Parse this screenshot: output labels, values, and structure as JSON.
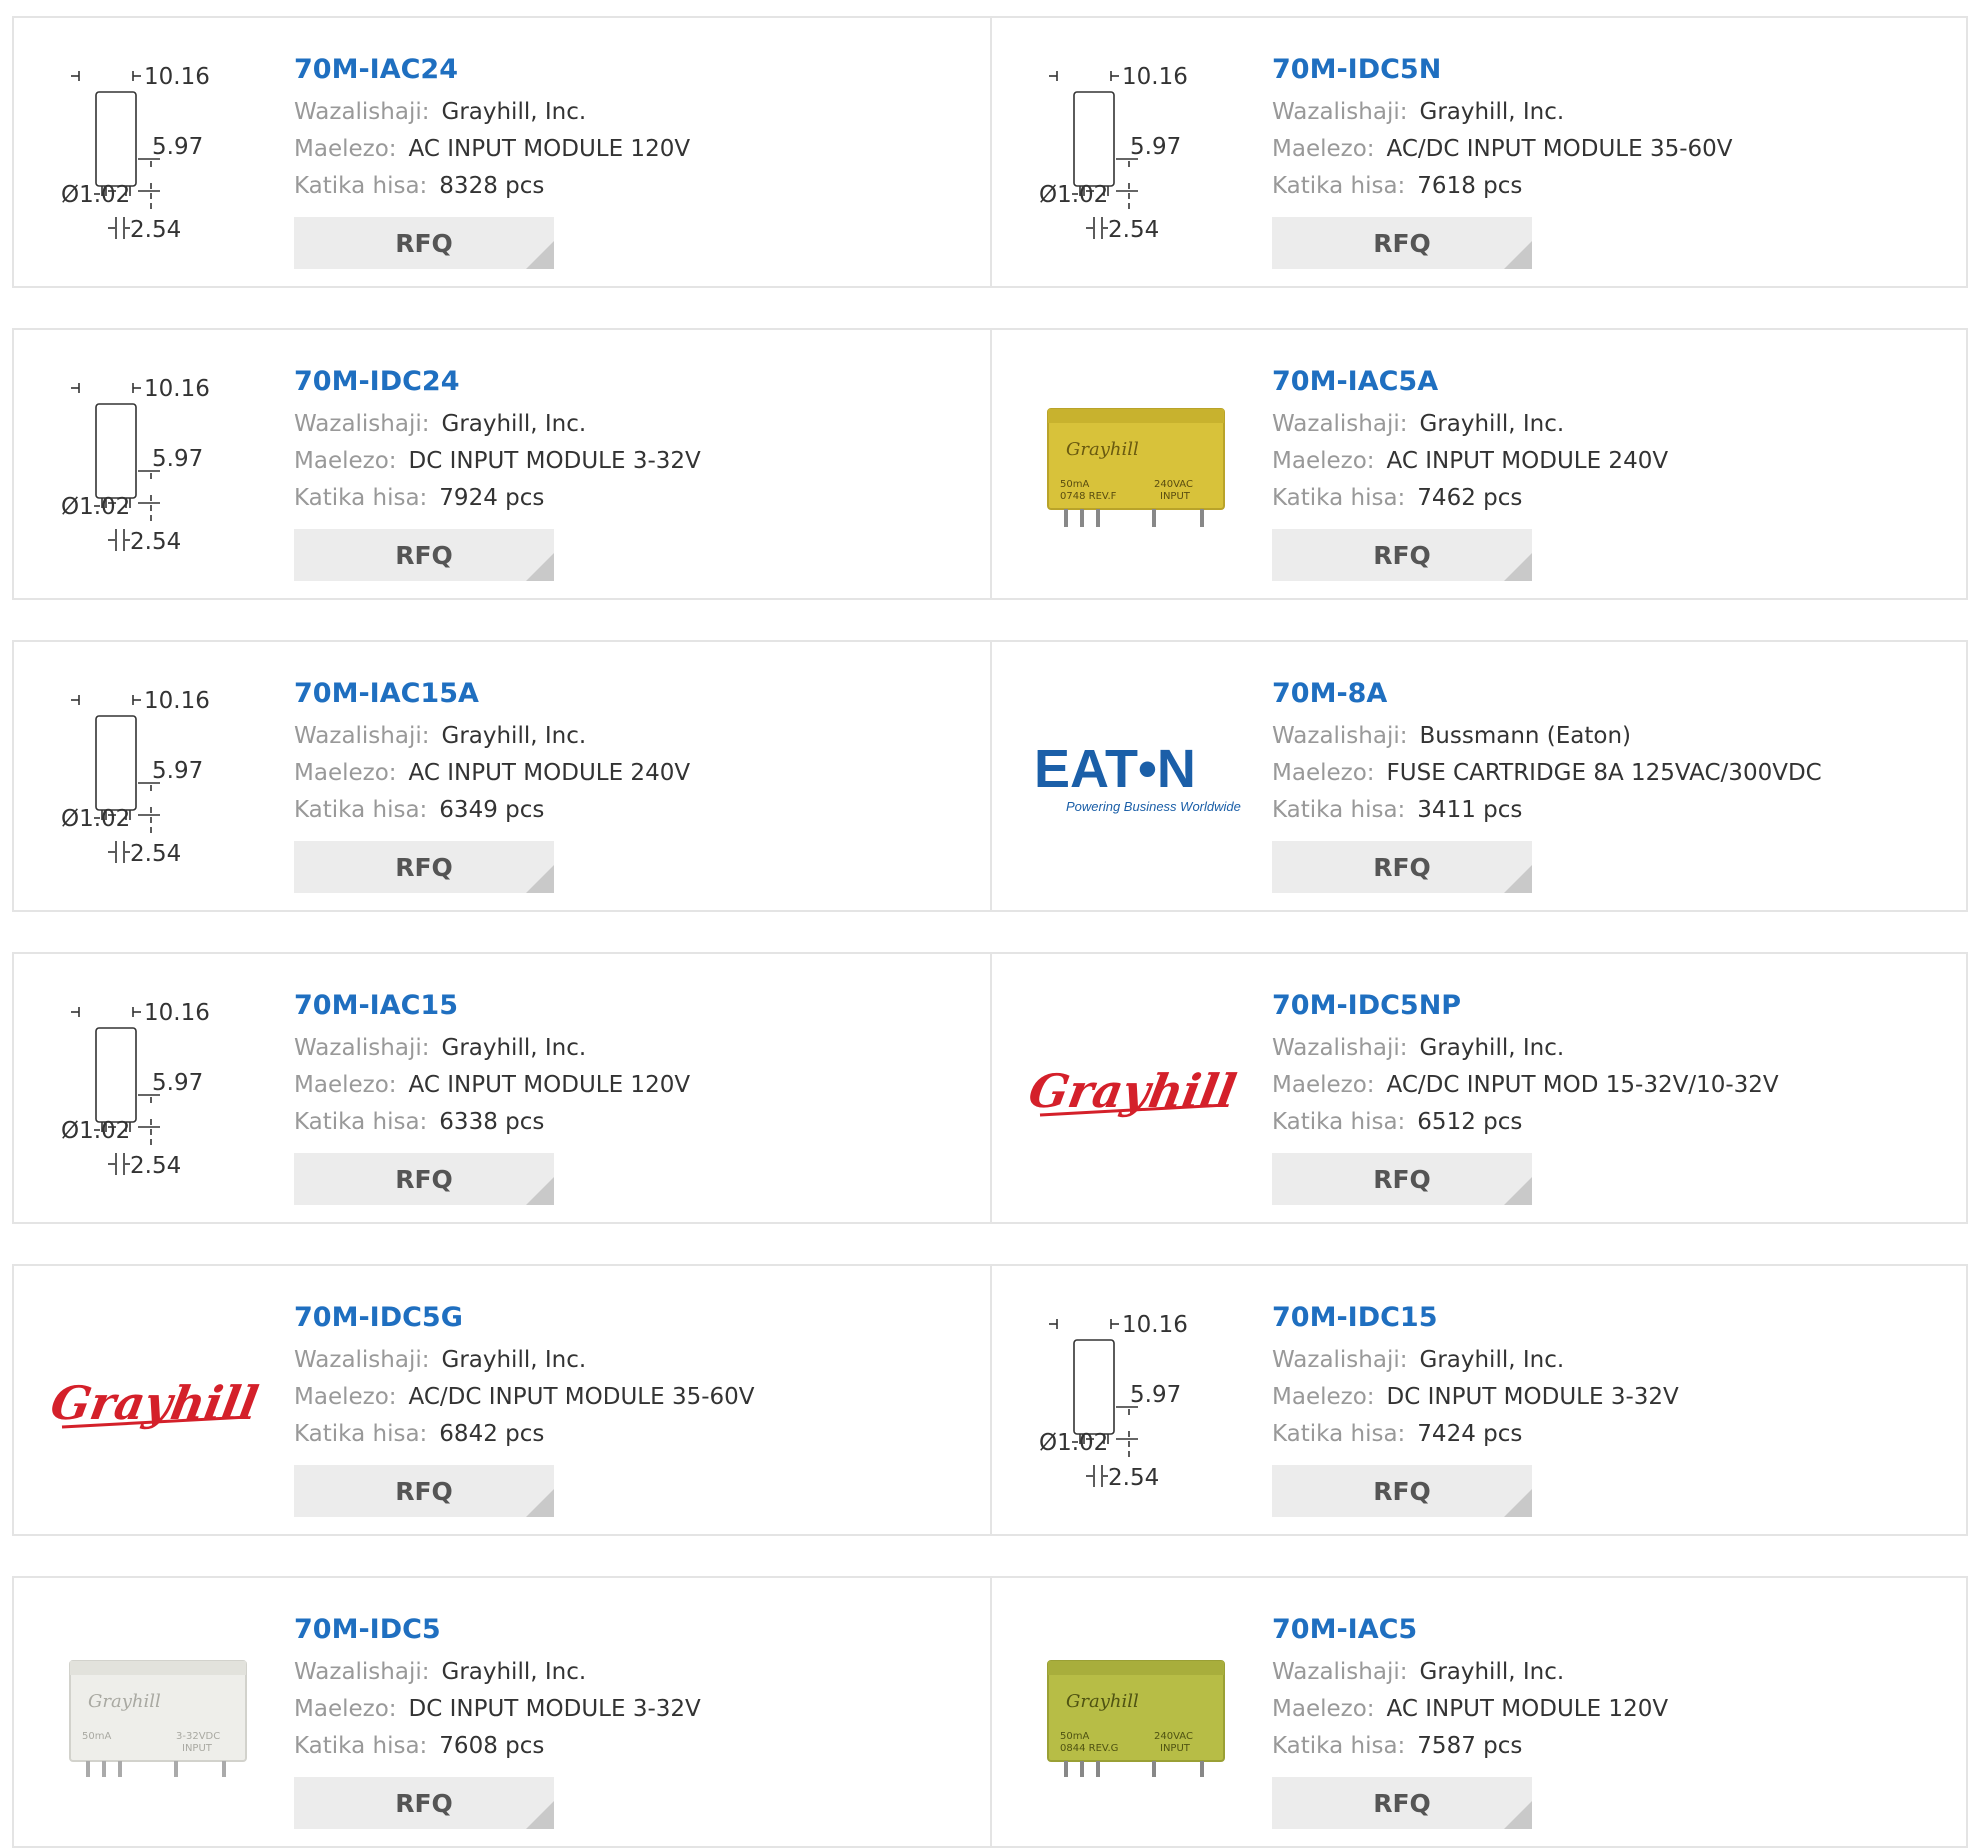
{
  "labels": {
    "manufacturer": "Wazalishaji:",
    "description": "Maelezo:",
    "stock": "Katika hisa:",
    "rfq": "RFQ"
  },
  "drawing_labels": {
    "width": "10.16",
    "height": "5.97",
    "pin_diameter": "Ø1.02",
    "pitch": "2.54"
  },
  "logos": {
    "eaton_name": "EAT•N",
    "eaton_tagline": "Powering Business Worldwide",
    "grayhill": "Grayhill"
  },
  "module_print": {
    "brand": "Grayhill",
    "current": "50mA",
    "yellow_voltage": "240VAC",
    "yellow_code": "0748 REV.F",
    "white_voltage": "3-32VDC",
    "green_voltage": "240VAC",
    "green_code": "0844 REV.G",
    "input": "INPUT"
  },
  "colors": {
    "link": "#1f6fc0",
    "eaton_blue": "#1b5fa8",
    "grayhill_red": "#d4202a",
    "module_yellow": "#d8c23a",
    "module_green": "#b7bd46",
    "module_white": "#eeeeea"
  },
  "products": [
    {
      "name": "70M-IAC24",
      "manufacturer": "Grayhill, Inc.",
      "description": "AC INPUT MODULE 120V",
      "stock": "8328 pcs",
      "image": "drawing"
    },
    {
      "name": "70M-IDC5N",
      "manufacturer": "Grayhill, Inc.",
      "description": "AC/DC INPUT MODULE 35-60V",
      "stock": "7618 pcs",
      "image": "drawing"
    },
    {
      "name": "70M-IDC24",
      "manufacturer": "Grayhill, Inc.",
      "description": "DC INPUT MODULE 3-32V",
      "stock": "7924 pcs",
      "image": "drawing"
    },
    {
      "name": "70M-IAC5A",
      "manufacturer": "Grayhill, Inc.",
      "description": "AC INPUT MODULE 240V",
      "stock": "7462 pcs",
      "image": "yellow-module"
    },
    {
      "name": "70M-IAC15A",
      "manufacturer": "Grayhill, Inc.",
      "description": "AC INPUT MODULE 240V",
      "stock": "6349 pcs",
      "image": "drawing"
    },
    {
      "name": "70M-8A",
      "manufacturer": "Bussmann (Eaton)",
      "description": "FUSE CARTRIDGE 8A 125VAC/300VDC",
      "stock": "3411 pcs",
      "image": "eaton-logo"
    },
    {
      "name": "70M-IAC15",
      "manufacturer": "Grayhill, Inc.",
      "description": "AC INPUT MODULE 120V",
      "stock": "6338 pcs",
      "image": "drawing"
    },
    {
      "name": "70M-IDC5NP",
      "manufacturer": "Grayhill, Inc.",
      "description": "AC/DC INPUT MOD 15-32V/10-32V",
      "stock": "6512 pcs",
      "image": "grayhill-logo"
    },
    {
      "name": "70M-IDC5G",
      "manufacturer": "Grayhill, Inc.",
      "description": "AC/DC INPUT MODULE 35-60V",
      "stock": "6842 pcs",
      "image": "grayhill-logo"
    },
    {
      "name": "70M-IDC15",
      "manufacturer": "Grayhill, Inc.",
      "description": "DC INPUT MODULE 3-32V",
      "stock": "7424 pcs",
      "image": "drawing"
    },
    {
      "name": "70M-IDC5",
      "manufacturer": "Grayhill, Inc.",
      "description": "DC INPUT MODULE 3-32V",
      "stock": "7608 pcs",
      "image": "white-module"
    },
    {
      "name": "70M-IAC5",
      "manufacturer": "Grayhill, Inc.",
      "description": "AC INPUT MODULE 120V",
      "stock": "7587 pcs",
      "image": "green-module"
    }
  ]
}
